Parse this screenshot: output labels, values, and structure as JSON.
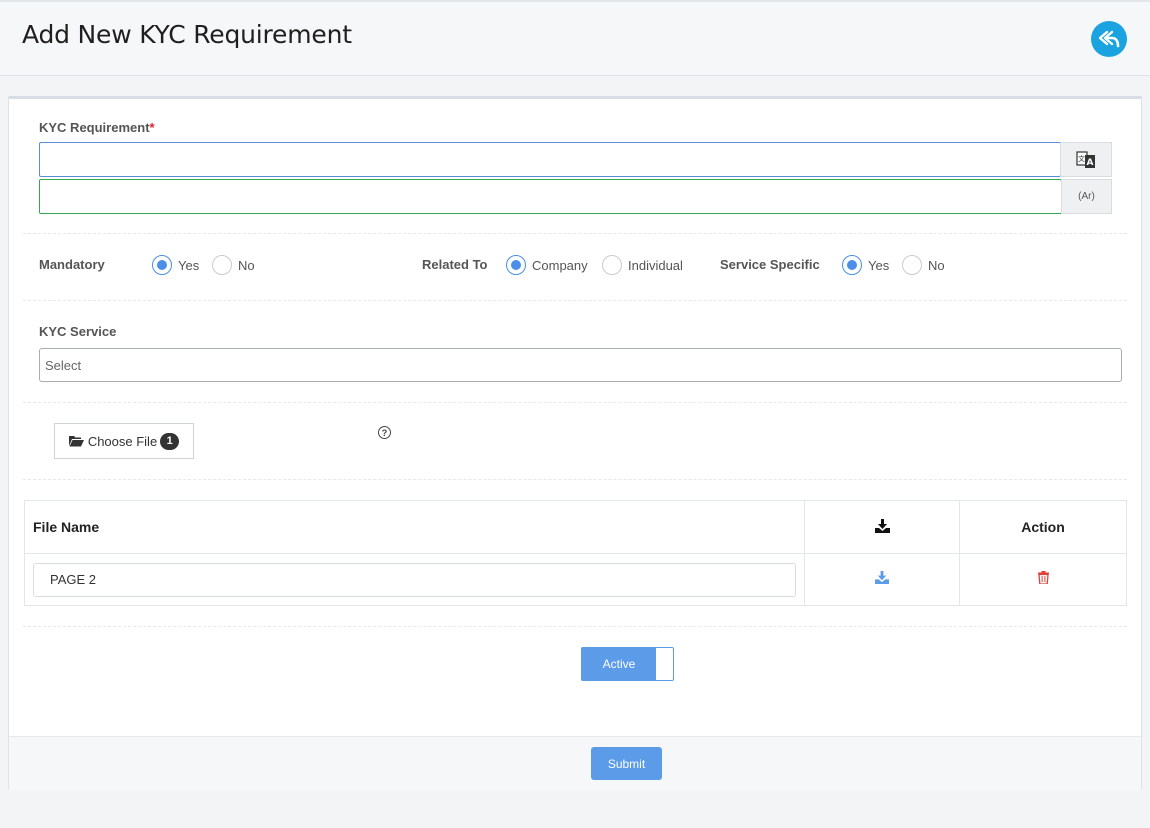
{
  "header": {
    "title": "Add New KYC Requirement"
  },
  "form": {
    "kyc_requirement_label": "KYC Requirement",
    "required_marker": "*",
    "english_value": "",
    "arabic_value": "",
    "arabic_addon": "(Ar)",
    "mandatory": {
      "label": "Mandatory",
      "options": [
        "Yes",
        "No"
      ],
      "selected": "Yes"
    },
    "related_to": {
      "label": "Related To",
      "options": [
        "Company",
        "Individual"
      ],
      "selected": "Company"
    },
    "service_specific": {
      "label": "Service Specific",
      "options": [
        "Yes",
        "No"
      ],
      "selected": "Yes"
    },
    "kyc_service": {
      "label": "KYC Service",
      "selected_value": "Select"
    },
    "choose_file_label": "Choose File",
    "file_count": "1",
    "help_icon_glyph": "?"
  },
  "table": {
    "headers": [
      "File Name",
      "",
      "Action"
    ],
    "rows": [
      {
        "file_name": "PAGE 2"
      }
    ]
  },
  "status_toggle": {
    "label": "Active",
    "state": "on"
  },
  "footer": {
    "submit_label": "Submit"
  },
  "colors": {
    "accent": "#5b9be8",
    "back_button": "#1ba3e0",
    "arabic_border": "#34a853",
    "english_border": "#5b8ddb",
    "delete": "#e0413a"
  }
}
